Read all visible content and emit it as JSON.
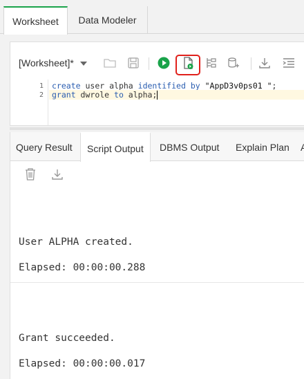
{
  "top_tabs": [
    {
      "label": "Worksheet",
      "active": true
    },
    {
      "label": "Data Modeler",
      "active": false
    }
  ],
  "toolbar": {
    "worksheet_select": "[Worksheet]*",
    "icons": [
      "folder-open-icon",
      "save-icon",
      "run-statement-icon",
      "run-script-icon",
      "explain-plan-icon",
      "autotrace-icon",
      "download-icon",
      "format-icon"
    ]
  },
  "editor": {
    "lines": [
      {
        "num": "1",
        "t1": "create",
        "t2": " user ",
        "t3": "alpha ",
        "t4": "identified",
        "t5": " by ",
        "t6": "\"AppD3v0ps01_\"",
        "t7": ";"
      },
      {
        "num": "2",
        "t1": "grant",
        "t2": " dwrole ",
        "t3": "to",
        "t4": " alpha;"
      }
    ]
  },
  "bottom_tabs": [
    {
      "label": "Query Result"
    },
    {
      "label": "Script Output",
      "active": true
    },
    {
      "label": "DBMS Output"
    },
    {
      "label": "Explain Plan"
    },
    {
      "label": "A"
    }
  ],
  "output": {
    "line1": "User ALPHA created.",
    "line2": "Elapsed: 00:00:00.288",
    "line3": "Grant succeeded.",
    "line4": "Elapsed: 00:00:00.017"
  },
  "colors": {
    "accent": "#1aa34a",
    "highlight": "#e0201b",
    "keyword": "#2a5db0"
  }
}
